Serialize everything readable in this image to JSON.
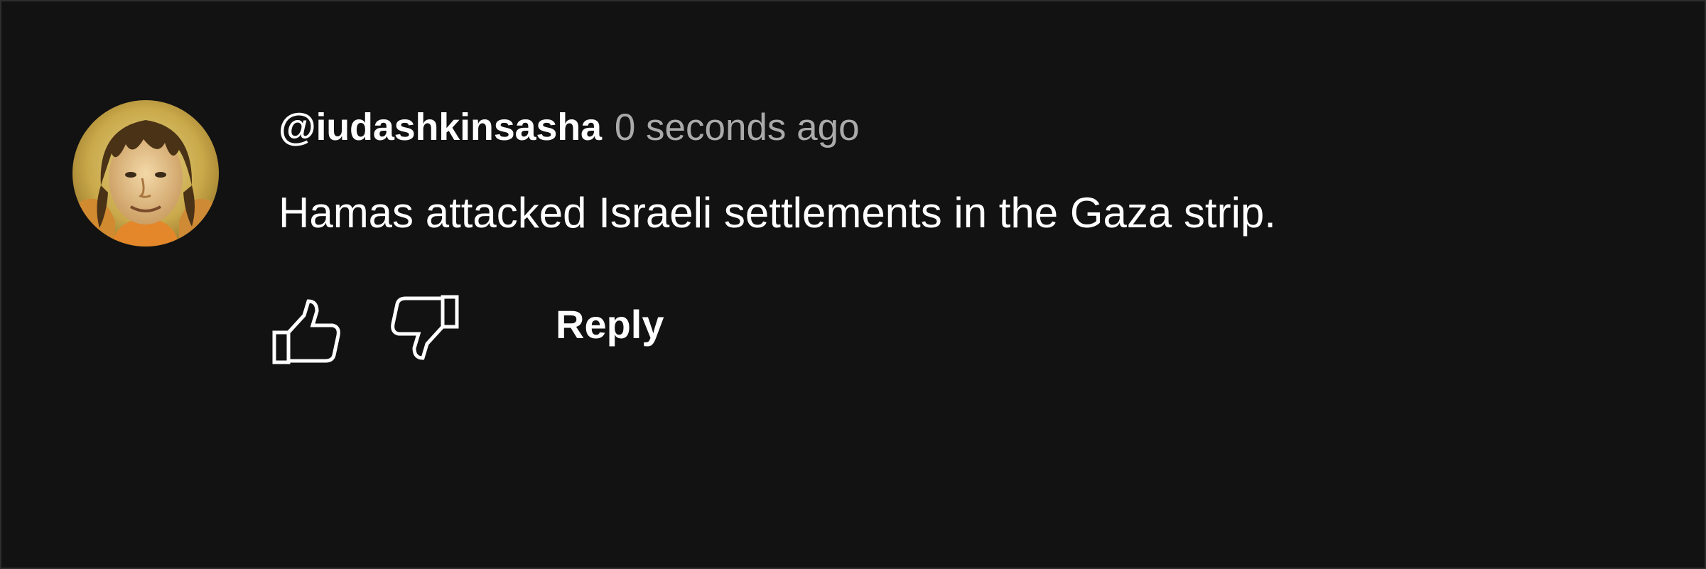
{
  "comment": {
    "author": "@iudashkinsasha",
    "timestamp": "0 seconds ago",
    "text": "Hamas attacked Israeli settlements in the Gaza strip.",
    "avatar_icon": "user-avatar-photo"
  },
  "actions": {
    "like_icon": "thumbs-up-icon",
    "dislike_icon": "thumbs-down-icon",
    "reply_label": "Reply"
  },
  "colors": {
    "background": "#121212",
    "frame_border": "#2e2e2e",
    "primary_text": "#ffffff",
    "secondary_text": "#aaaaaa"
  }
}
